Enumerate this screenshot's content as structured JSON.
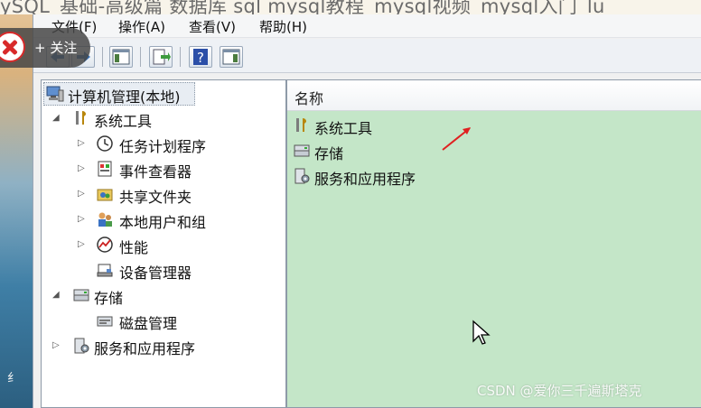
{
  "caption": "ySQL_基础-高级篇 数据库 sql mysql教程_mysql视频_mysql入门_lu",
  "background": {
    "sidebar_char": "纟"
  },
  "overlay": {
    "follow_label": "+ 关注"
  },
  "menu": [
    "文件(F)",
    "操作(A)",
    "查看(V)",
    "帮助(H)"
  ],
  "toolbar": {
    "buttons": [
      "back-icon",
      "forward-icon",
      "show-hide-tree-icon",
      "export-list-icon",
      "help-icon",
      "show-hide-action-pane-icon"
    ]
  },
  "tree": {
    "root": "计算机管理(本地)",
    "system_tools": {
      "label": "系统工具",
      "children": [
        "任务计划程序",
        "事件查看器",
        "共享文件夹",
        "本地用户和组",
        "性能",
        "设备管理器"
      ]
    },
    "storage": {
      "label": "存储",
      "children": [
        "磁盘管理"
      ]
    },
    "services": {
      "label": "服务和应用程序"
    }
  },
  "list": {
    "header": "名称",
    "items": [
      "系统工具",
      "存储",
      "服务和应用程序"
    ]
  },
  "colors": {
    "list_bg": "#c4e6c8",
    "annotation": "#e02020"
  },
  "watermark": "CSDN @爱你三千遍斯塔克"
}
